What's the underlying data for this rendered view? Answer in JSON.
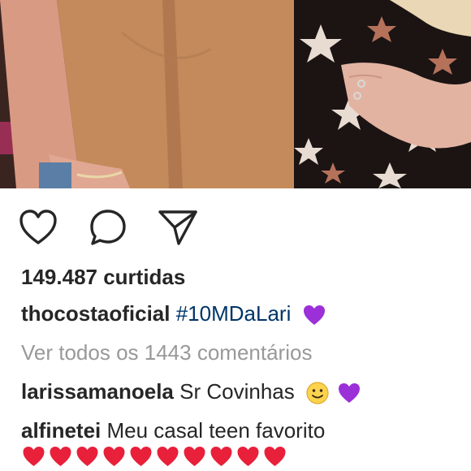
{
  "post": {
    "image_alt": "",
    "likes_text": "149.487 curtidas",
    "caption": {
      "username": "thocostaoficial",
      "hashtag": "#10MDaLari",
      "emoji": "purple-heart"
    },
    "view_all_comments": "Ver todos os 1443 comentários",
    "comments": [
      {
        "username": "larissamanoela",
        "text": "Sr Covinhas",
        "emojis": [
          "smiling-face",
          "purple-heart"
        ]
      },
      {
        "username": "alfinetei",
        "text": "Meu casal teen favorito",
        "emojis": [
          "red-heart",
          "red-heart",
          "red-heart",
          "red-heart",
          "red-heart",
          "red-heart",
          "red-heart",
          "red-heart",
          "red-heart",
          "red-heart"
        ]
      }
    ]
  },
  "actions": {
    "like_icon": "heart-outline-icon",
    "comment_icon": "comment-bubble-icon",
    "share_icon": "paper-plane-icon"
  },
  "colors": {
    "text": "#262626",
    "hashtag": "#003569",
    "muted": "#999999",
    "purple_heart": "#9b30d9",
    "red_heart": "#e8203a"
  }
}
